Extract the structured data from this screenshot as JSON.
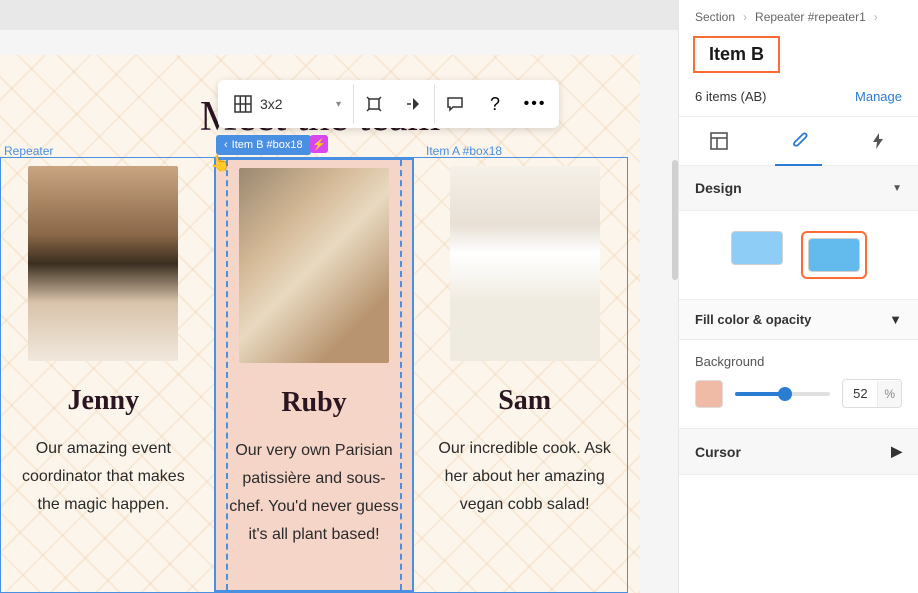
{
  "breadcrumb": {
    "a": "Section",
    "b": "Repeater #repeater1"
  },
  "panel": {
    "title": "Item B",
    "items_text": "6 items (AB)",
    "manage": "Manage",
    "design_label": "Design",
    "fill_label": "Fill color & opacity",
    "background_label": "Background",
    "opacity_value": "52",
    "opacity_unit": "%",
    "cursor_label": "Cursor"
  },
  "toolbar": {
    "grid": "3x2"
  },
  "labels": {
    "repeater": "Repeater",
    "itemb_tag": "Item B #box18",
    "itema_tag": "Item A #box18"
  },
  "heading": "Meet the team",
  "cards": [
    {
      "name": "Jenny",
      "desc": "Our amazing event coordinator that makes the magic happen."
    },
    {
      "name": "Ruby",
      "desc": "Our very own Parisian patissière and sous-chef. You'd never guess it's all plant based!"
    },
    {
      "name": "Sam",
      "desc": "Our incredible cook. Ask her about her amazing vegan cobb salad!"
    }
  ],
  "colors": {
    "accent": "#2b7cd3",
    "highlight": "#ff6b35",
    "bg_swatch": "#efbba6"
  }
}
